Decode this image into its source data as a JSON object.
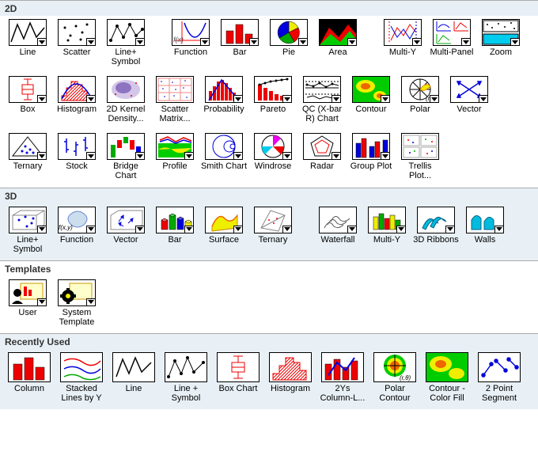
{
  "sections": {
    "twoD": {
      "title": "2D"
    },
    "threeD": {
      "title": "3D"
    },
    "templates": {
      "title": "Templates"
    },
    "recent": {
      "title": "Recently Used"
    }
  },
  "twoD_row1": [
    {
      "label": "Line"
    },
    {
      "label": "Scatter"
    },
    {
      "label": "Line+ Symbol"
    },
    {
      "label": "Function"
    },
    {
      "label": "Bar"
    },
    {
      "label": "Pie"
    },
    {
      "label": "Area"
    },
    {
      "label": "Multi-Y"
    },
    {
      "label": "Multi-Panel"
    },
    {
      "label": "Zoom"
    }
  ],
  "twoD_row2": [
    {
      "label": "Box"
    },
    {
      "label": "Histogram"
    },
    {
      "label": "2D Kernel Density..."
    },
    {
      "label": "Scatter Matrix..."
    },
    {
      "label": "Probability"
    },
    {
      "label": "Pareto"
    },
    {
      "label": "QC (X-bar R) Chart"
    },
    {
      "label": "Contour"
    },
    {
      "label": "Polar"
    },
    {
      "label": "Vector"
    }
  ],
  "twoD_row3": [
    {
      "label": "Ternary"
    },
    {
      "label": "Stock"
    },
    {
      "label": "Bridge Chart"
    },
    {
      "label": "Profile"
    },
    {
      "label": "Smith Chart"
    },
    {
      "label": "Windrose"
    },
    {
      "label": "Radar"
    },
    {
      "label": "Group Plot"
    },
    {
      "label": "Trellis Plot..."
    }
  ],
  "threeD_row": [
    {
      "label": "Line+ Symbol"
    },
    {
      "label": "Function"
    },
    {
      "label": "Vector"
    },
    {
      "label": "Bar"
    },
    {
      "label": "Surface"
    },
    {
      "label": "Ternary"
    },
    {
      "label": "Waterfall"
    },
    {
      "label": "Multi-Y"
    },
    {
      "label": "3D Ribbons"
    },
    {
      "label": "Walls"
    }
  ],
  "templates_row": [
    {
      "label": "User"
    },
    {
      "label": "System Template"
    }
  ],
  "recent_row": [
    {
      "label": "Column"
    },
    {
      "label": "Stacked Lines by Y"
    },
    {
      "label": "Line"
    },
    {
      "label": "Line + Symbol"
    },
    {
      "label": "Box Chart"
    },
    {
      "label": "Histogram"
    },
    {
      "label": "2Ys Column-L..."
    },
    {
      "label": "Polar Contour"
    },
    {
      "label": "Contour - Color Fill"
    },
    {
      "label": "2 Point Segment"
    }
  ]
}
